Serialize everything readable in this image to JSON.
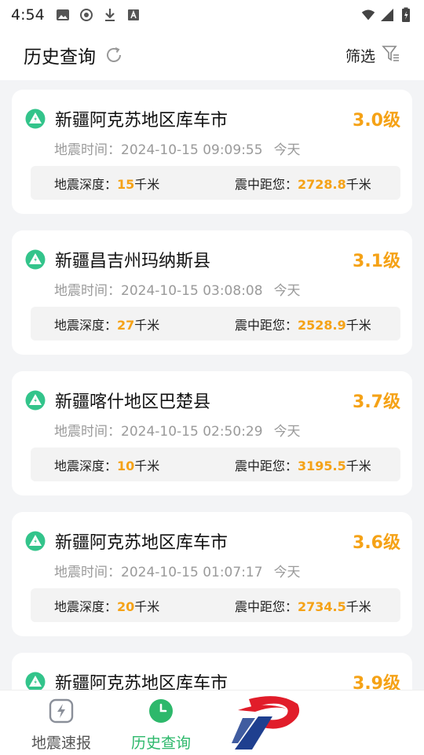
{
  "statusbar": {
    "time": "4:54",
    "left_icons": [
      "image-icon",
      "record-icon",
      "download-icon",
      "font-icon"
    ],
    "right_icons": [
      "wifi-icon",
      "signal-icon",
      "battery-icon"
    ]
  },
  "header": {
    "title": "历史查询",
    "filter_label": "筛选"
  },
  "labels": {
    "time_prefix": "地震时间：",
    "depth_prefix": "地震深度：",
    "distance_prefix": "震中距您：",
    "unit_km": "千米"
  },
  "quakes": [
    {
      "place": "新疆阿克苏地区库车市",
      "magnitude": "3.0级",
      "time": "2024-10-15 09:09:55",
      "day": "今天",
      "depth": "15",
      "distance": "2728.8"
    },
    {
      "place": "新疆昌吉州玛纳斯县",
      "magnitude": "3.1级",
      "time": "2024-10-15 03:08:08",
      "day": "今天",
      "depth": "27",
      "distance": "2528.9"
    },
    {
      "place": "新疆喀什地区巴楚县",
      "magnitude": "3.7级",
      "time": "2024-10-15 02:50:29",
      "day": "今天",
      "depth": "10",
      "distance": "3195.5"
    },
    {
      "place": "新疆阿克苏地区库车市",
      "magnitude": "3.6级",
      "time": "2024-10-15 01:07:17",
      "day": "今天",
      "depth": "20",
      "distance": "2734.5"
    },
    {
      "place": "新疆阿克苏地区库车市",
      "magnitude": "3.9级",
      "time": "",
      "day": "",
      "depth": "",
      "distance": ""
    }
  ],
  "bottom_nav": [
    {
      "label": "地震速报",
      "icon": "lightning-icon",
      "active": false
    },
    {
      "label": "历史查询",
      "icon": "clock-icon",
      "active": true
    }
  ],
  "colors": {
    "accent_orange": "#f5a216",
    "accent_green": "#2db86b",
    "background": "#f3f4f6"
  }
}
